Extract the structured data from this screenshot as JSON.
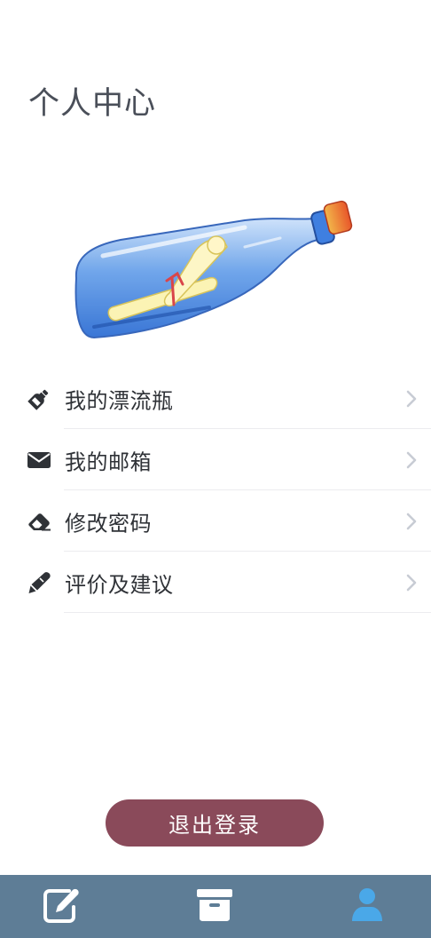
{
  "page": {
    "title": "个人中心"
  },
  "hero": {
    "image": "bottle-with-message-illustration"
  },
  "menu": {
    "items": [
      {
        "label": "我的漂流瓶",
        "icon": "bottle-icon"
      },
      {
        "label": "我的邮箱",
        "icon": "envelope-icon"
      },
      {
        "label": "修改密码",
        "icon": "eraser-icon"
      },
      {
        "label": "评价及建议",
        "icon": "pen-icon"
      }
    ],
    "chevron_icon": "chevron-right-icon"
  },
  "logout": {
    "label": "退出登录"
  },
  "tabbar": {
    "tabs": [
      {
        "icon": "edit-icon"
      },
      {
        "icon": "archive-box-icon"
      },
      {
        "icon": "user-icon",
        "active": true
      }
    ],
    "active_color": "#4aa8e8",
    "inactive_color": "#ffffff",
    "background": "#5e7d96"
  },
  "colors": {
    "logout_button": "#8a4a5a",
    "text": "#2f3237",
    "chevron": "#c8ccd4"
  }
}
